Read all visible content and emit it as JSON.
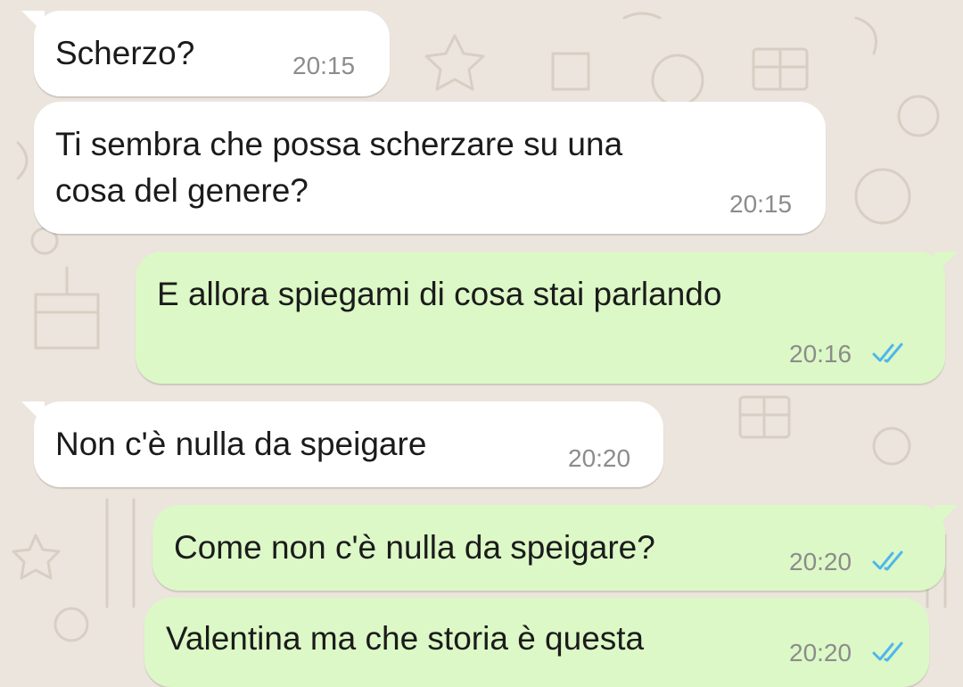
{
  "chat": {
    "accent_read_ticks": "#4fb6ec",
    "bubble_incoming": "#ffffff",
    "bubble_outgoing": "#dcf8c6",
    "messages": [
      {
        "direction": "in",
        "text": "Scherzo?",
        "time": "20:15"
      },
      {
        "direction": "in",
        "line1": "Ti sembra che possa scherzare su una",
        "line2": "cosa del genere?",
        "time": "20:15"
      },
      {
        "direction": "out",
        "text": "E allora spiegami di cosa stai parlando",
        "time": "20:16",
        "status": "read"
      },
      {
        "direction": "in",
        "text": "Non c'è nulla da speigare",
        "time": "20:20"
      },
      {
        "direction": "out",
        "text": "Come non c'è nulla da speigare?",
        "time": "20:20",
        "status": "read"
      },
      {
        "direction": "out",
        "text": "Valentina ma che storia è questa",
        "time": "20:20",
        "status": "read"
      }
    ]
  }
}
